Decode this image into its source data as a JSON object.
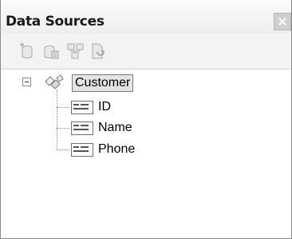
{
  "panel": {
    "title": "Data Sources"
  },
  "toolbar": {
    "buttons": [
      {
        "name": "add-data-source",
        "icon": "database-add-icon",
        "enabled": false
      },
      {
        "name": "edit-dataset",
        "icon": "database-edit-icon",
        "enabled": false
      },
      {
        "name": "configure-dataset",
        "icon": "database-configure-icon",
        "enabled": false
      },
      {
        "name": "refresh",
        "icon": "refresh-icon",
        "enabled": false
      }
    ]
  },
  "tree": {
    "root": {
      "label": "Customer",
      "icon": "object-icon",
      "expanded": true,
      "selected": true
    },
    "children": [
      {
        "label": "ID",
        "icon": "textbox-icon"
      },
      {
        "label": "Name",
        "icon": "textbox-icon"
      },
      {
        "label": "Phone",
        "icon": "textbox-icon"
      }
    ]
  }
}
